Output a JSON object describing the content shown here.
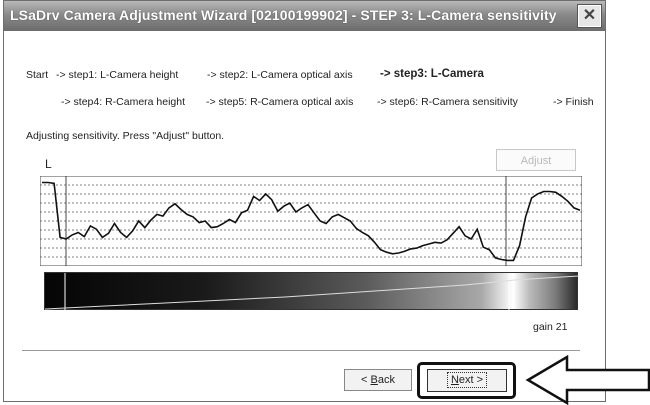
{
  "window": {
    "title": "LSaDrv Camera Adjustment Wizard [02100199902] - STEP 3: L-Camera sensitivity",
    "close_glyph": "✕"
  },
  "steps": {
    "row1": [
      {
        "text": "Start",
        "current": false
      },
      {
        "text": "-> step1: L-Camera height",
        "current": false
      },
      {
        "text": "-> step2: L-Camera optical axis",
        "current": false
      },
      {
        "text": "-> step3: L-Camera",
        "current": true
      }
    ],
    "row2": [
      {
        "text": "-> step4: R-Camera height",
        "current": false
      },
      {
        "text": "-> step5: R-Camera optical axis",
        "current": false
      },
      {
        "text": "-> step6: R-Camera sensitivity",
        "current": false
      },
      {
        "text": "-> Finish",
        "current": false
      }
    ]
  },
  "instruction": "Adjusting sensitivity. Press \"Adjust\" button.",
  "camera_label": "L",
  "adjust_button": "Adjust",
  "gain_label": "gain 21",
  "back_button": {
    "prefix": "< ",
    "mnemonic": "B",
    "rest": "ack"
  },
  "next_button": {
    "mnemonic": "N",
    "rest": "ext >"
  },
  "signal_profile": [
    0.97,
    0.97,
    0.96,
    0.3,
    0.28,
    0.33,
    0.36,
    0.31,
    0.44,
    0.4,
    0.3,
    0.35,
    0.47,
    0.36,
    0.3,
    0.38,
    0.5,
    0.42,
    0.51,
    0.58,
    0.56,
    0.66,
    0.71,
    0.64,
    0.58,
    0.55,
    0.48,
    0.5,
    0.42,
    0.43,
    0.47,
    0.52,
    0.48,
    0.6,
    0.63,
    0.8,
    0.75,
    0.83,
    0.76,
    0.62,
    0.68,
    0.72,
    0.61,
    0.66,
    0.7,
    0.6,
    0.5,
    0.47,
    0.55,
    0.58,
    0.54,
    0.5,
    0.41,
    0.36,
    0.32,
    0.24,
    0.15,
    0.12,
    0.1,
    0.11,
    0.13,
    0.16,
    0.17,
    0.2,
    0.22,
    0.24,
    0.23,
    0.27,
    0.35,
    0.43,
    0.32,
    0.28,
    0.4,
    0.18,
    0.15,
    0.05,
    0.03,
    0.02,
    0.02,
    0.2,
    0.55,
    0.78,
    0.83,
    0.86,
    0.86,
    0.85,
    0.8,
    0.74,
    0.66,
    0.63
  ],
  "icons": {
    "close": "close-icon",
    "arrow": "pointer-arrow-icon"
  }
}
